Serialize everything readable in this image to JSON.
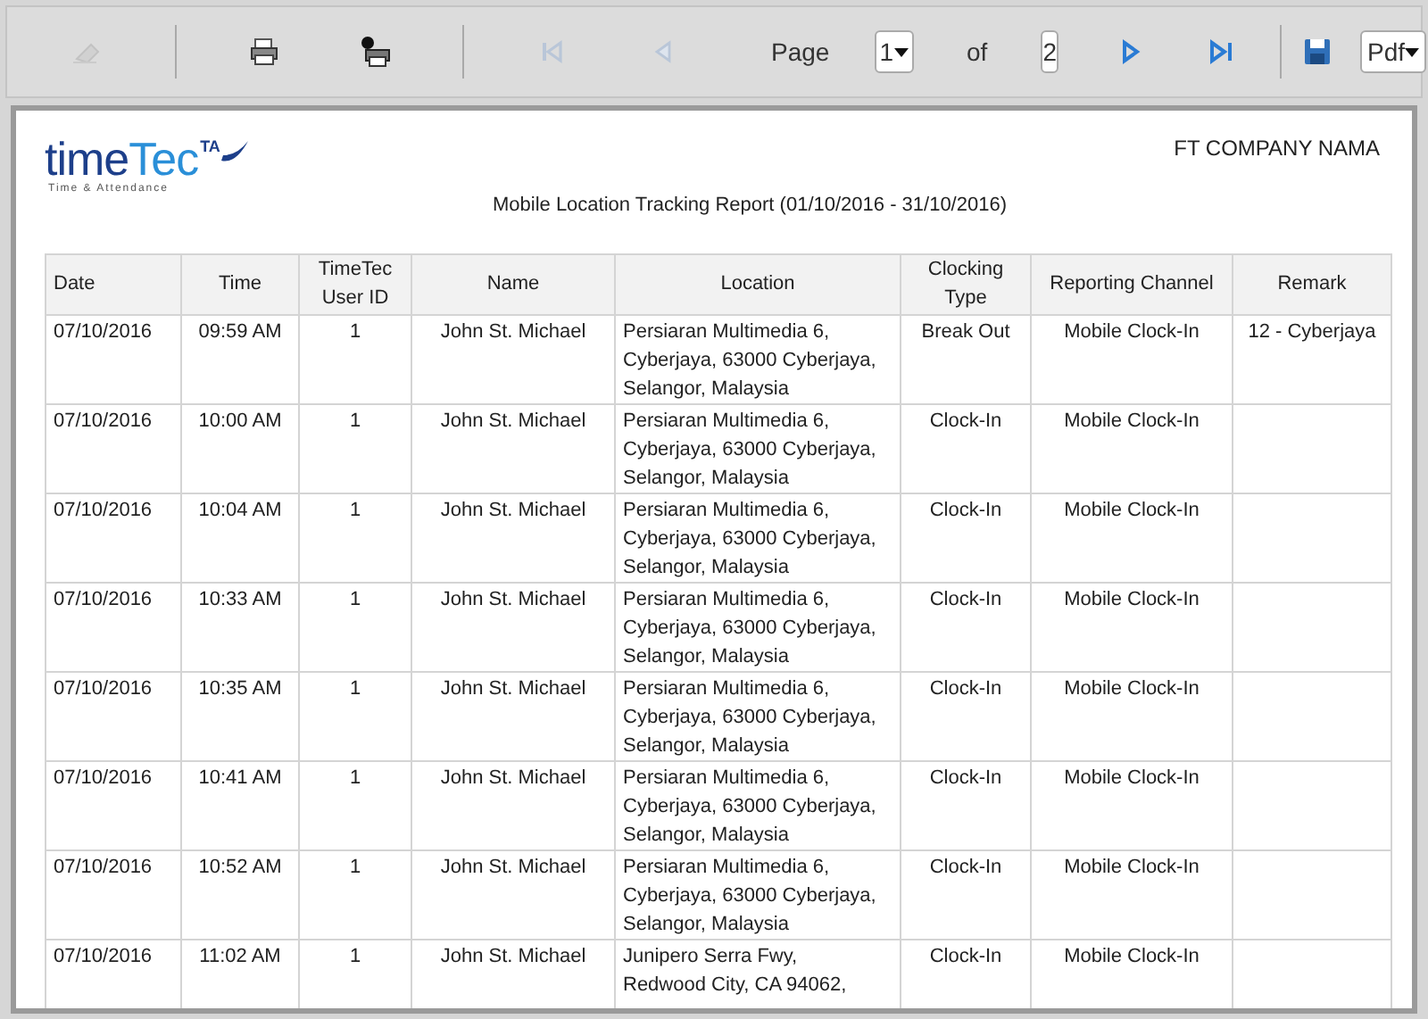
{
  "toolbar": {
    "buttons": [
      {
        "kind": "hide",
        "disabled": true
      },
      {
        "kind": "sep"
      },
      {
        "kind": "print",
        "disabled": false
      },
      {
        "kind": "print-setup",
        "disabled": false
      },
      {
        "kind": "sep"
      },
      {
        "kind": "first",
        "disabled": true
      },
      {
        "kind": "prev",
        "disabled": true
      }
    ],
    "page_label": "Page",
    "page_value": "1",
    "of_label": "of",
    "page_count": "2",
    "nav_buttons": [
      {
        "kind": "next",
        "disabled": false
      },
      {
        "kind": "last",
        "disabled": false
      }
    ],
    "format": "Pdf"
  },
  "report": {
    "logo": {
      "word_1": "time",
      "word_2": "Tec",
      "badge": "TA",
      "tagline": "Time & Attendance"
    },
    "company": "FT COMPANY NAMA",
    "title": "Mobile Location Tracking Report (01/10/2016 - 31/10/2016)",
    "table": {
      "columns": [
        "Date",
        "Time",
        "TimeTec User ID",
        "Name",
        "Location",
        "Clocking Type",
        "Reporting Channel",
        "Remark"
      ],
      "rows": [
        [
          "07/10/2016",
          "09:59 AM",
          "1",
          "John St. Michael",
          "Persiaran Multimedia 6, Cyberjaya, 63000 Cyberjaya, Selangor, Malaysia",
          "Break Out",
          "Mobile Clock-In",
          "12 - Cyberjaya"
        ],
        [
          "07/10/2016",
          "10:00 AM",
          "1",
          "John St. Michael",
          "Persiaran Multimedia 6, Cyberjaya, 63000 Cyberjaya, Selangor, Malaysia",
          "Clock-In",
          "Mobile Clock-In",
          ""
        ],
        [
          "07/10/2016",
          "10:04 AM",
          "1",
          "John St. Michael",
          "Persiaran Multimedia 6, Cyberjaya, 63000 Cyberjaya, Selangor, Malaysia",
          "Clock-In",
          "Mobile Clock-In",
          ""
        ],
        [
          "07/10/2016",
          "10:33 AM",
          "1",
          "John St. Michael",
          "Persiaran Multimedia 6, Cyberjaya, 63000 Cyberjaya, Selangor, Malaysia",
          "Clock-In",
          "Mobile Clock-In",
          ""
        ],
        [
          "07/10/2016",
          "10:35 AM",
          "1",
          "John St. Michael",
          "Persiaran Multimedia 6, Cyberjaya, 63000 Cyberjaya, Selangor, Malaysia",
          "Clock-In",
          "Mobile Clock-In",
          ""
        ],
        [
          "07/10/2016",
          "10:41 AM",
          "1",
          "John St. Michael",
          "Persiaran Multimedia 6, Cyberjaya, 63000 Cyberjaya, Selangor, Malaysia",
          "Clock-In",
          "Mobile Clock-In",
          ""
        ],
        [
          "07/10/2016",
          "10:52 AM",
          "1",
          "John St. Michael",
          "Persiaran Multimedia 6, Cyberjaya, 63000 Cyberjaya, Selangor, Malaysia",
          "Clock-In",
          "Mobile Clock-In",
          ""
        ],
        [
          "07/10/2016",
          "11:02 AM",
          "1",
          "John St. Michael",
          [
            "Junipero Serra Fwy,",
            "Redwood City, CA 94062,"
          ],
          "Clock-In",
          "Mobile Clock-In",
          ""
        ]
      ]
    }
  }
}
